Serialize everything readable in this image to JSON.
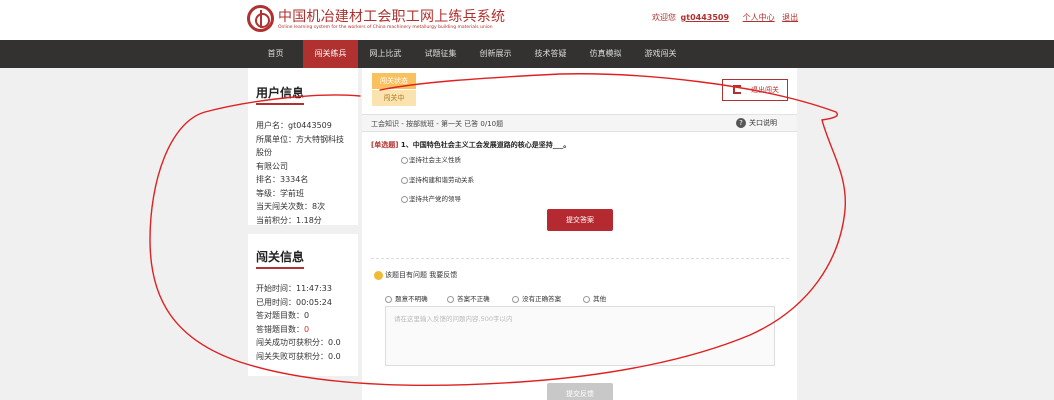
{
  "header": {
    "title": "中国机冶建材工会职工网上练兵系统",
    "subtitle": "Online learning system for the workers of China machinery metallurgy building materials union",
    "welcome": "欢迎您",
    "username": "gt0443509",
    "links": {
      "personal": "个人中心",
      "logout": "退出"
    }
  },
  "nav": [
    "首页",
    "闯关练兵",
    "网上比武",
    "试题征集",
    "创新展示",
    "技术答疑",
    "仿真模拟",
    "游戏闯关"
  ],
  "user_info": {
    "heading": "用户信息",
    "lines": [
      "用户名：gt0443509",
      "所属单位：方大特钢科技股份",
      "有限公司",
      "排名：3334名",
      "等级：学前班",
      "当天闯关次数：8次",
      "当前积分：1.18分"
    ]
  },
  "level_info": {
    "heading": "闯关信息",
    "start_time": "开始时间：11:47:33",
    "elapsed": "已用时间：00:05:24",
    "correct": "答对题目数：0",
    "wrong_label": "答错题目数：",
    "wrong_value": "0",
    "success_points": "闯关成功可获积分：0.0",
    "fail_points": "闯关失败可获积分：0.0"
  },
  "main": {
    "status_label": "闯关状态",
    "status_value": "闯关中",
    "exit_label": "退出闯关",
    "breadcrumb": "工会知识 - 按部就班 - 第一关 已答 0/10题",
    "help_label": "关口说明",
    "question_type": "[单选题]",
    "question_text": " 1、中国特色社会主义工会发展道路的核心是坚持___。",
    "options": [
      "坚持社会主义性质",
      "坚持构建和谐劳动关系",
      "坚持共产党的领导"
    ],
    "submit_label": "提交答案",
    "feedback": {
      "title": "该题目有问题 我要反馈",
      "options": [
        "题意不明确",
        "答案不正确",
        "没有正确答案",
        "其他"
      ],
      "placeholder": "请在这里输入反馈的问题内容,500字以内",
      "submit_label": "提交反馈"
    }
  },
  "colors": {
    "brand": "#b0312f",
    "nav_bg": "#333230",
    "annotation": "#e02020"
  },
  "icons": [
    "logo-emblem-icon",
    "exit-door-icon",
    "help-circle-icon",
    "smile-icon"
  ]
}
